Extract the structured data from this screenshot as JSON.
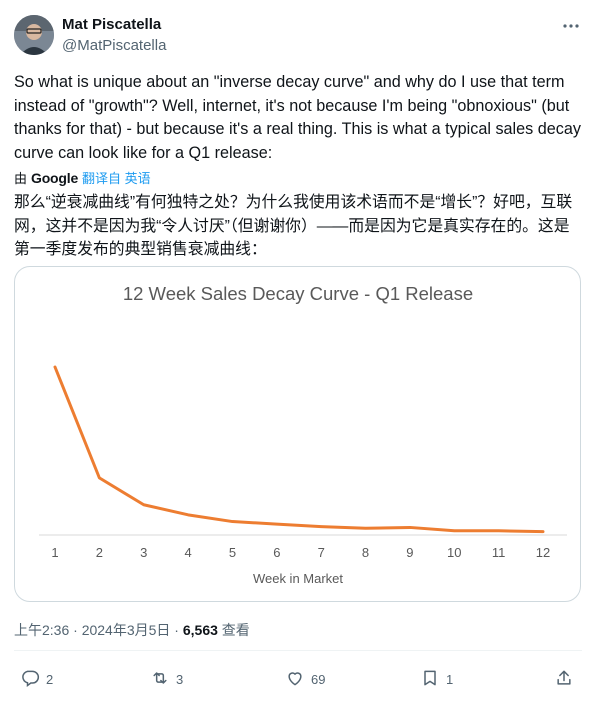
{
  "author": {
    "display_name": "Mat Piscatella",
    "handle": "@MatPiscatella"
  },
  "tweet": {
    "text": "So what is unique about an \"inverse decay curve\" and why do I use that term instead of \"growth\"? Well, internet, it's not because I'm being \"obnoxious\" (but thanks for that) - but because it's a real thing. This is what a typical sales decay curve can look like for a Q1 release:",
    "translated_prefix": "由",
    "translated_brand": "Google",
    "translated_link": "翻译自 英语",
    "translated_text": "那么“逆衰减曲线”有何独特之处？为什么我使用该术语而不是“增长”？好吧，互联网，这并不是因为我“令人讨厌”（但谢谢你）——而是因为它是真实存在的。这是第一季度发布的典型销售衰减曲线："
  },
  "meta": {
    "time_date": "上午2:36 · 2024年3月5日 · ",
    "views": "6,563",
    "views_label": " 查看"
  },
  "actions": {
    "replies": "2",
    "reposts": "3",
    "likes": "69",
    "bookmarks": "1"
  },
  "icons": [
    "more-icon",
    "reply-icon",
    "repost-icon",
    "like-icon",
    "bookmark-icon",
    "share-icon"
  ],
  "colors": {
    "line": "#ed7d31",
    "link": "#1d9bf0"
  },
  "chart_data": {
    "type": "line",
    "title": "12 Week Sales Decay Curve - Q1 Release",
    "xlabel": "Week in Market",
    "ylabel": "",
    "x": [
      1,
      2,
      3,
      4,
      5,
      6,
      7,
      8,
      9,
      10,
      11,
      12
    ],
    "values": [
      100,
      34,
      18,
      12,
      8,
      6.5,
      5,
      4,
      4.5,
      2.5,
      2.5,
      2
    ],
    "y_axis_shown": false,
    "grid": false,
    "legend": "none"
  }
}
